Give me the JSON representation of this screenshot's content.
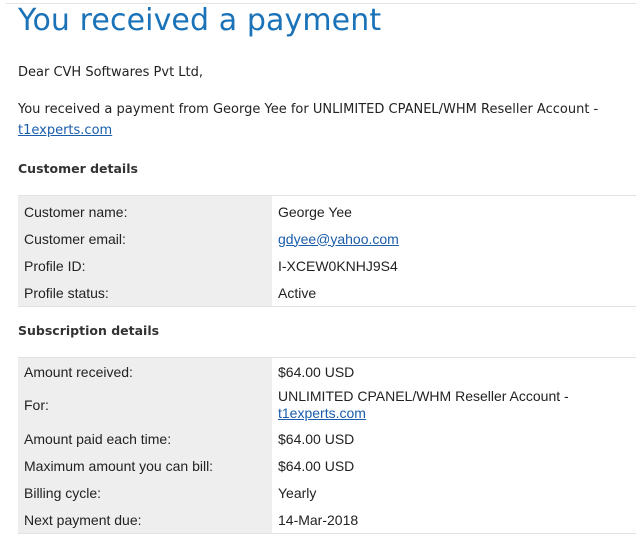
{
  "page_title": "You received a payment",
  "greeting": "Dear CVH Softwares Pvt Ltd,",
  "intro": {
    "text": "You received a payment from George Yee for UNLIMITED CPANEL/WHM Reseller Account -",
    "link": "t1experts.com"
  },
  "customer_section": {
    "heading": "Customer details",
    "rows": [
      {
        "label": "Customer name:",
        "value": "George Yee"
      },
      {
        "label": "Customer email:",
        "value": "gdyee@yahoo.com"
      },
      {
        "label": "Profile ID:",
        "value": "I-XCEW0KNHJ9S4"
      },
      {
        "label": "Profile status:",
        "value": "Active"
      }
    ]
  },
  "subscription_section": {
    "heading": "Subscription details",
    "rows": [
      {
        "label": "Amount received:",
        "value": "$64.00 USD"
      },
      {
        "label": "For:",
        "value": "UNLIMITED CPANEL/WHM Reseller Account -",
        "link": "t1experts.com"
      },
      {
        "label": "Amount paid each time:",
        "value": "$64.00 USD"
      },
      {
        "label": "Maximum amount you can bill:",
        "value": "$64.00 USD"
      },
      {
        "label": "Billing cycle:",
        "value": "Yearly"
      },
      {
        "label": "Next payment due:",
        "value": "14-Mar-2018"
      }
    ]
  }
}
